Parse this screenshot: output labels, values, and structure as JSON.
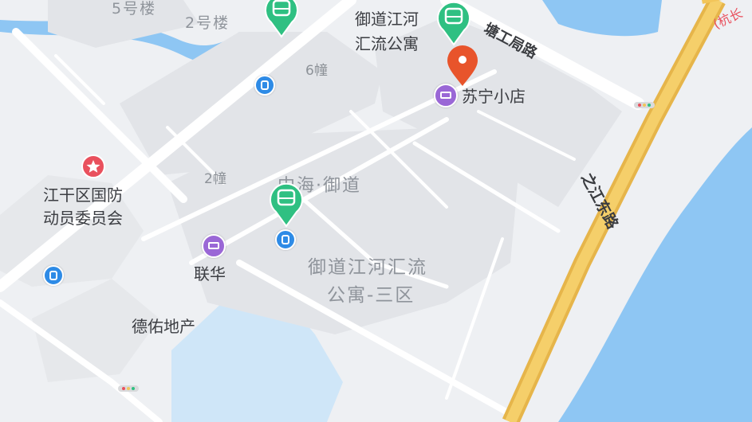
{
  "map": {
    "colors": {
      "water": "#8ec6f3",
      "land": "#eef0f3",
      "block": "#e2e4e8",
      "road": "#ffffff",
      "highway": "#f2c55a",
      "bus_pin": "#2fc082",
      "location_pin": "#e8542b",
      "shop_pin": "#9a67d6",
      "bus_stop": "#2e8be6",
      "gov_poi": "#e9505d"
    },
    "labels": {
      "building_5": "5号楼",
      "building_2_lou": "2号楼",
      "yudao_apartment_line1": "御道江河",
      "yudao_apartment_line2": "汇流公寓",
      "building_6": "6幢",
      "suning_store": "苏宁小店",
      "tanggongju_road": "塘工局路",
      "building_2": "2幢",
      "zhonghai_yudao": "中海·御道",
      "jianggan_defense_line1": "江干区国防",
      "jianggan_defense_line2": "动员委员会",
      "lianhua": "联华",
      "zone3_line1": "御道江河汇流",
      "zone3_line2": "公寓-三区",
      "deyou_realestate": "德佑地产",
      "zhijiang_east_road": "之江东路",
      "corner_text": "(杭长"
    },
    "icons": [
      "bus-station-pin",
      "location-pin",
      "shop-pin",
      "bus-stop-icon",
      "government-star-icon",
      "traffic-light-icon"
    ]
  }
}
